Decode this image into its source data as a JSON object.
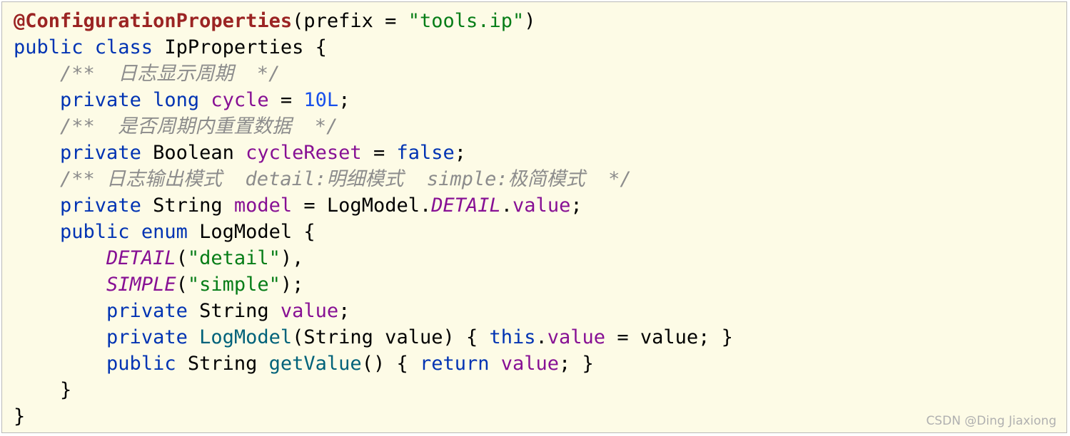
{
  "code_lines": [
    [
      {
        "t": "@ConfigurationProperties",
        "k": "annotation"
      },
      {
        "t": "(prefix = ",
        "k": "plain"
      },
      {
        "t": "\"tools.ip\"",
        "k": "string"
      },
      {
        "t": ")",
        "k": "plain"
      }
    ],
    [
      {
        "t": "public class ",
        "k": "keyword"
      },
      {
        "t": "IpProperties {",
        "k": "plain"
      }
    ],
    [
      {
        "t": "    /**  日志显示周期  */",
        "k": "comment"
      }
    ],
    [
      {
        "t": "    ",
        "k": "plain"
      },
      {
        "t": "private long ",
        "k": "keyword"
      },
      {
        "t": "cycle",
        "k": "field"
      },
      {
        "t": " = ",
        "k": "plain"
      },
      {
        "t": "10L",
        "k": "number"
      },
      {
        "t": ";",
        "k": "plain"
      }
    ],
    [
      {
        "t": "    /**  是否周期内重置数据  */",
        "k": "comment"
      }
    ],
    [
      {
        "t": "    ",
        "k": "plain"
      },
      {
        "t": "private ",
        "k": "keyword"
      },
      {
        "t": "Boolean ",
        "k": "plain"
      },
      {
        "t": "cycleReset",
        "k": "field"
      },
      {
        "t": " = ",
        "k": "plain"
      },
      {
        "t": "false",
        "k": "keyword"
      },
      {
        "t": ";",
        "k": "plain"
      }
    ],
    [
      {
        "t": "    /** 日志输出模式  detail:明细模式  simple:极简模式  */",
        "k": "comment"
      }
    ],
    [
      {
        "t": "    ",
        "k": "plain"
      },
      {
        "t": "private ",
        "k": "keyword"
      },
      {
        "t": "String ",
        "k": "plain"
      },
      {
        "t": "model",
        "k": "field"
      },
      {
        "t": " = LogModel.",
        "k": "plain"
      },
      {
        "t": "DETAIL",
        "k": "constant"
      },
      {
        "t": ".",
        "k": "plain"
      },
      {
        "t": "value",
        "k": "field"
      },
      {
        "t": ";",
        "k": "plain"
      }
    ],
    [
      {
        "t": "    ",
        "k": "plain"
      },
      {
        "t": "public enum ",
        "k": "keyword"
      },
      {
        "t": "LogModel {",
        "k": "plain"
      }
    ],
    [
      {
        "t": "        ",
        "k": "plain"
      },
      {
        "t": "DETAIL",
        "k": "constant"
      },
      {
        "t": "(",
        "k": "plain"
      },
      {
        "t": "\"detail\"",
        "k": "string"
      },
      {
        "t": "),",
        "k": "plain"
      }
    ],
    [
      {
        "t": "        ",
        "k": "plain"
      },
      {
        "t": "SIMPLE",
        "k": "constant"
      },
      {
        "t": "(",
        "k": "plain"
      },
      {
        "t": "\"simple\"",
        "k": "string"
      },
      {
        "t": ");",
        "k": "plain"
      }
    ],
    [
      {
        "t": "        ",
        "k": "plain"
      },
      {
        "t": "private ",
        "k": "keyword"
      },
      {
        "t": "String ",
        "k": "plain"
      },
      {
        "t": "value",
        "k": "field"
      },
      {
        "t": ";",
        "k": "plain"
      }
    ],
    [
      {
        "t": "        ",
        "k": "plain"
      },
      {
        "t": "private ",
        "k": "keyword"
      },
      {
        "t": "LogModel",
        "k": "method"
      },
      {
        "t": "(String value) { ",
        "k": "plain"
      },
      {
        "t": "this",
        "k": "keyword"
      },
      {
        "t": ".",
        "k": "plain"
      },
      {
        "t": "value",
        "k": "field"
      },
      {
        "t": " = value; }",
        "k": "plain"
      }
    ],
    [
      {
        "t": "        ",
        "k": "plain"
      },
      {
        "t": "public ",
        "k": "keyword"
      },
      {
        "t": "String ",
        "k": "plain"
      },
      {
        "t": "getValue",
        "k": "method"
      },
      {
        "t": "() { ",
        "k": "plain"
      },
      {
        "t": "return ",
        "k": "keyword"
      },
      {
        "t": "value",
        "k": "field"
      },
      {
        "t": "; }",
        "k": "plain"
      }
    ],
    [
      {
        "t": "    }",
        "k": "plain"
      }
    ],
    [
      {
        "t": "}",
        "k": "plain"
      }
    ]
  ],
  "watermark": "CSDN @Ding Jiaxiong"
}
